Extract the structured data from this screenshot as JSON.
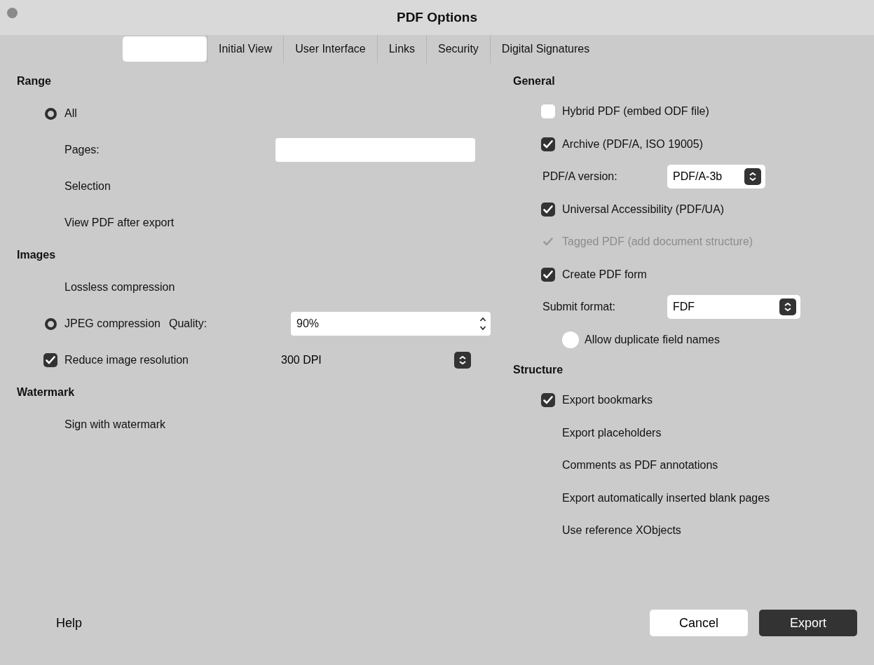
{
  "window": {
    "title": "PDF Options"
  },
  "tabs": [
    {
      "selected": true
    },
    {
      "label": "Initial View",
      "selected": false
    },
    {
      "label": "User Interface",
      "selected": false
    },
    {
      "label": "Links",
      "selected": false
    },
    {
      "label": "Security",
      "selected": false
    },
    {
      "label": "Digital Signatures",
      "selected": false
    }
  ],
  "left_sections": [
    {
      "heading": "Range",
      "rows": [
        {
          "kind": "radio",
          "label": "All",
          "selected": true
        },
        {
          "kind": "field",
          "label": "Pages:"
        },
        {
          "kind": "text",
          "label": "Selection"
        },
        {
          "kind": "text",
          "label": "View PDF after export"
        }
      ]
    },
    {
      "heading": "Images",
      "rows": [
        {
          "kind": "text",
          "label": "Lossless compression"
        },
        {
          "kind": "radio_spin",
          "label": "JPEG compression",
          "selected": true,
          "field_label": "Quality:",
          "value": "90%"
        },
        {
          "kind": "checkbox_select",
          "label": "Reduce image resolution",
          "checked": true,
          "value": "300 DPI"
        }
      ]
    },
    {
      "heading": "Watermark",
      "rows": [
        {
          "kind": "text",
          "label": "Sign with watermark"
        }
      ]
    }
  ],
  "right_sections": [
    {
      "heading": "General",
      "rows": [
        {
          "kind": "checkbox",
          "label": "Hybrid PDF (embed ODF file)",
          "checked": false,
          "disabled": false
        },
        {
          "kind": "checkbox",
          "label": "Archive (PDF/A, ISO 19005)",
          "checked": true,
          "disabled": false
        },
        {
          "kind": "select",
          "label": "PDF/A version:",
          "value": "PDF/A-3b"
        },
        {
          "kind": "checkbox",
          "label": "Universal Accessibility (PDF/UA)",
          "checked": true,
          "disabled": false
        },
        {
          "kind": "checkbox",
          "label": "Tagged PDF (add document structure)",
          "checked": true,
          "disabled": true
        },
        {
          "kind": "checkbox",
          "label": "Create PDF form",
          "checked": true,
          "disabled": false
        },
        {
          "kind": "select",
          "label": "Submit format:",
          "value": "FDF"
        },
        {
          "kind": "subcheckbox",
          "label": "Allow duplicate field names",
          "checked": false
        }
      ]
    },
    {
      "heading": "Structure",
      "rows": [
        {
          "kind": "checkbox",
          "label": "Export bookmarks",
          "checked": true,
          "disabled": false
        },
        {
          "kind": "text",
          "label": "Export placeholders"
        },
        {
          "kind": "text",
          "label": "Comments as PDF annotations"
        },
        {
          "kind": "text",
          "label": "Export automatically inserted blank pages"
        },
        {
          "kind": "text",
          "label": "Use reference XObjects"
        }
      ]
    }
  ],
  "footer": {
    "help": "Help",
    "cancel": "Cancel",
    "export": "Export"
  }
}
